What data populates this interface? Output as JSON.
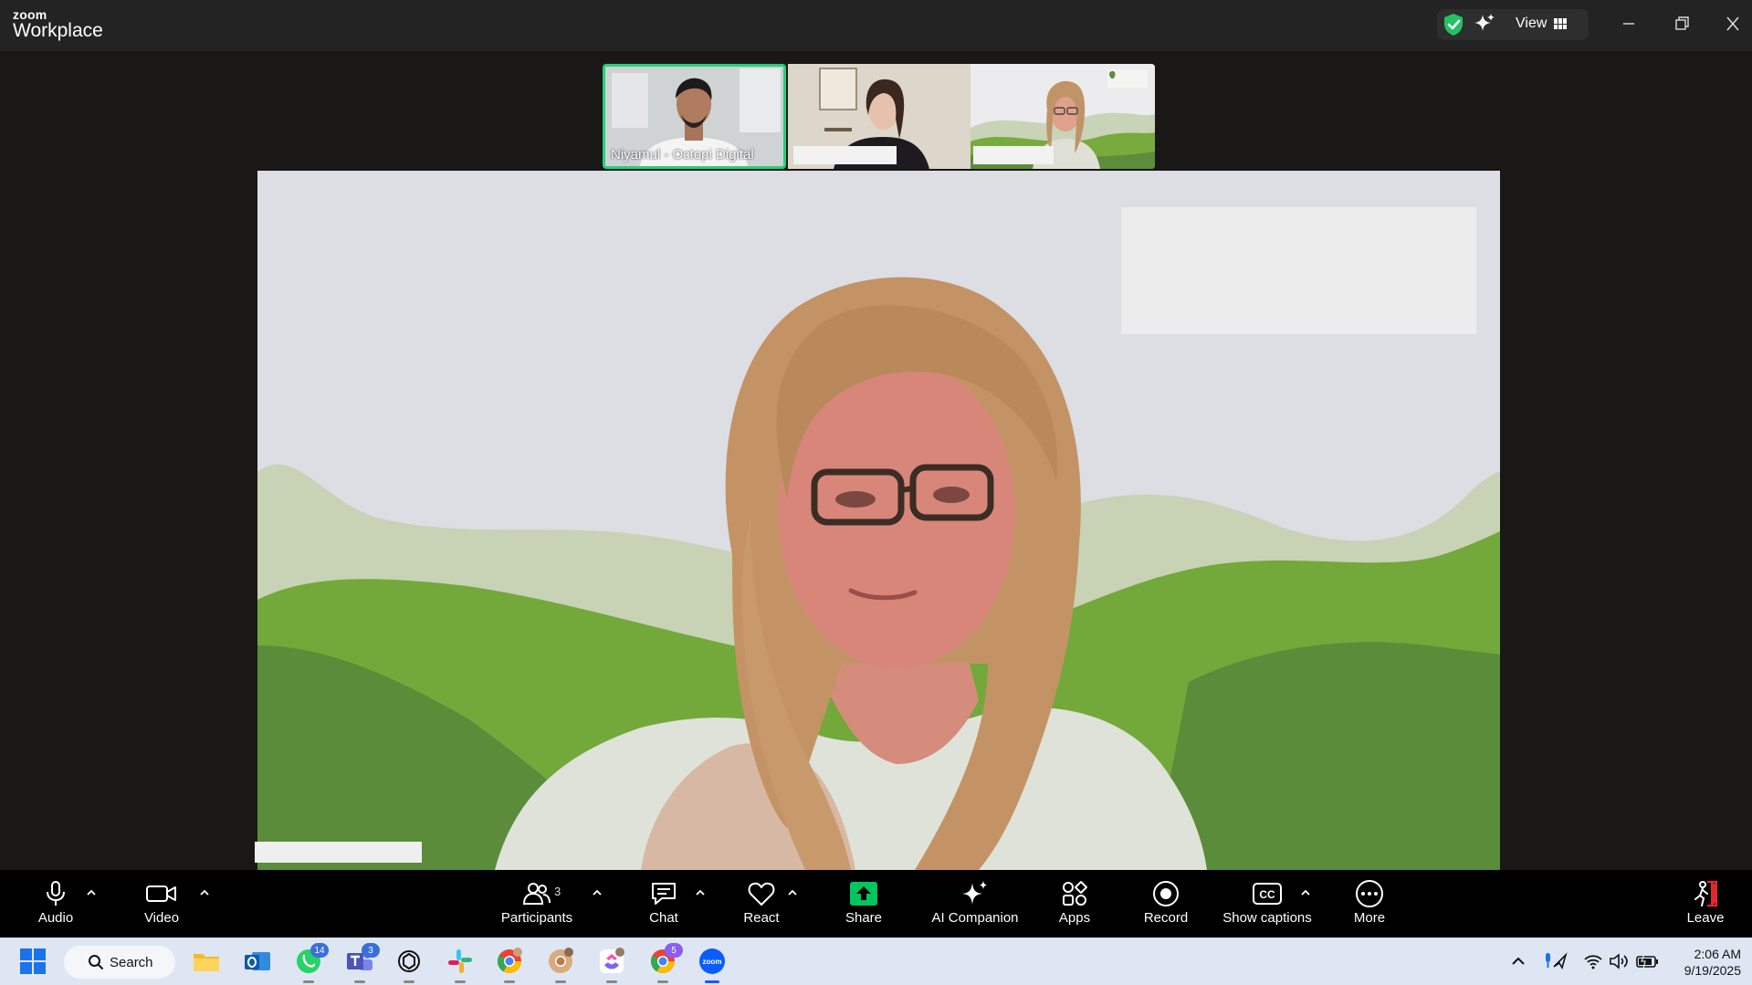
{
  "app": {
    "brand_small": "zoom",
    "brand_big": "Workplace"
  },
  "titlebar": {
    "view_label": "View"
  },
  "thumbnails": [
    {
      "name": "Niyamul - Octopi Digital",
      "active": true
    },
    {
      "name": "",
      "active": false
    },
    {
      "name": "",
      "active": false
    }
  ],
  "toolbar": {
    "audio": "Audio",
    "video": "Video",
    "participants": "Participants",
    "participants_count": "3",
    "chat": "Chat",
    "react": "React",
    "share": "Share",
    "ai_companion": "AI Companion",
    "apps": "Apps",
    "record": "Record",
    "show_captions": "Show captions",
    "more": "More",
    "leave": "Leave"
  },
  "taskbar": {
    "search_label": "Search",
    "whatsapp_badge": "14",
    "teams_badge": "3",
    "chrome3_badge": "5",
    "time": "2:06 AM",
    "date": "9/19/2025"
  },
  "colors": {
    "active_speaker_border": "#25d17b",
    "share_green": "#00c65e",
    "leave_red": "#e0282e",
    "hill_dark": "#5a8c3a",
    "hill_mid": "#73a83a",
    "hill_light": "#c8d2b4"
  }
}
